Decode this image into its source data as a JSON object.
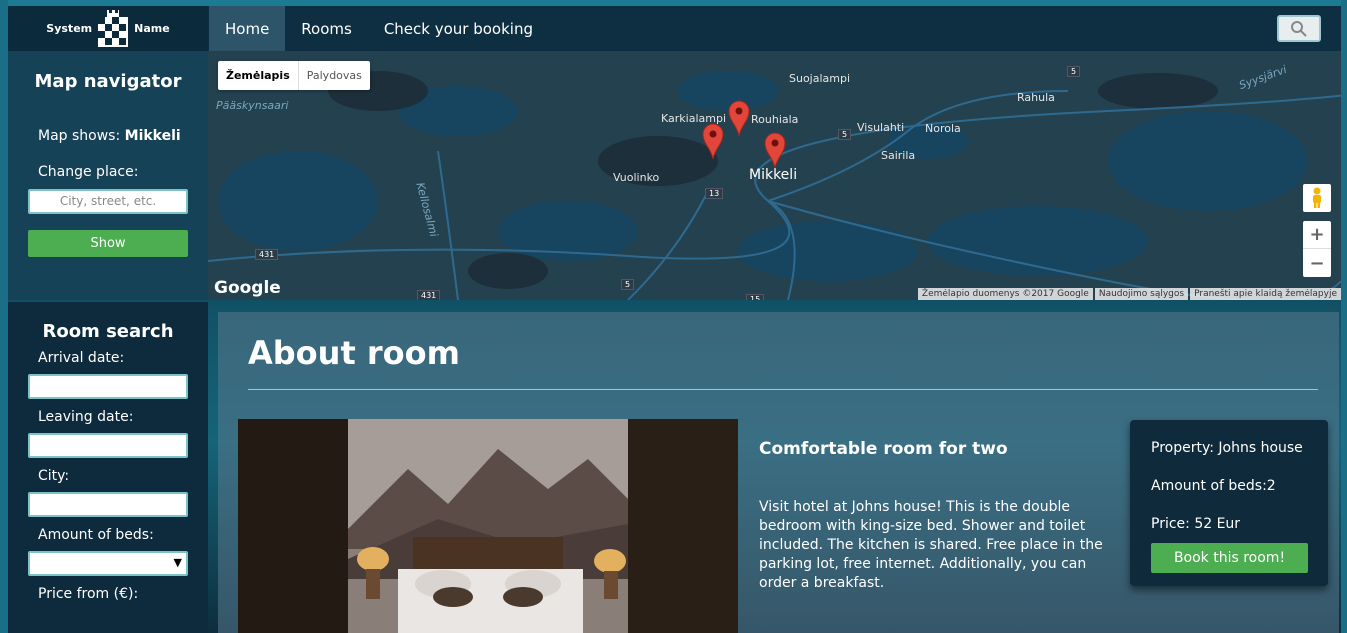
{
  "header": {
    "logo_left": "System",
    "logo_right": "Name",
    "nav": [
      {
        "label": "Home",
        "active": true
      },
      {
        "label": "Rooms",
        "active": false
      },
      {
        "label": "Check your booking",
        "active": false
      }
    ],
    "search_icon": "search-icon"
  },
  "map_navigator": {
    "title": "Map navigator",
    "shows_prefix": "Map shows: ",
    "shows_value": "Mikkeli",
    "change_label": "Change place:",
    "place_placeholder": "City, street, etc.",
    "show_button": "Show"
  },
  "map": {
    "tabs": [
      "Žemėlapis",
      "Palydovas"
    ],
    "labels": {
      "paaskynsaari": "Pääskynsaari",
      "karkialampi": "Karkialampi",
      "rouhiala": "Rouhiala",
      "suojalampi": "Suojalampi",
      "rahula": "Rahula",
      "syysjarvi": "Syysjärvi",
      "visulahti": "Visulahti",
      "norola": "Norola",
      "sairila": "Sairila",
      "vuolinko": "Vuolinko",
      "mikkeli": "Mikkeli",
      "kellosalmi": "Kellosalmi"
    },
    "roads": [
      "5",
      "5",
      "13",
      "431",
      "431",
      "5",
      "15"
    ],
    "google": "Google",
    "attribution": [
      "Žemėlapio duomenys ©2017 Google",
      "Naudojimo sąlygos",
      "Pranešti apie klaidą žemėlapyje"
    ],
    "zoom_in": "+",
    "zoom_out": "−"
  },
  "room_search": {
    "title": "Room search",
    "arrival_label": "Arrival date:",
    "leaving_label": "Leaving date:",
    "city_label": "City:",
    "beds_label": "Amount of beds:",
    "price_label": "Price from (€):"
  },
  "about": {
    "title": "About room",
    "room_title": "Comfortable room for two",
    "description": "Visit hotel at Johns house! This is the double bedroom with king-size bed. Shower and toilet included. The kitchen is shared. Free place in the parking lot, free internet. Additionally, you can order a breakfast.",
    "property": "Property: Johns house",
    "beds": "Amount of beds:2",
    "price": "Price: 52 Eur",
    "book_button": "Book this room!"
  },
  "colors": {
    "accent_green": "#4cae50",
    "nav_bg": "#0e2f42",
    "panel_bg": "#164257"
  }
}
